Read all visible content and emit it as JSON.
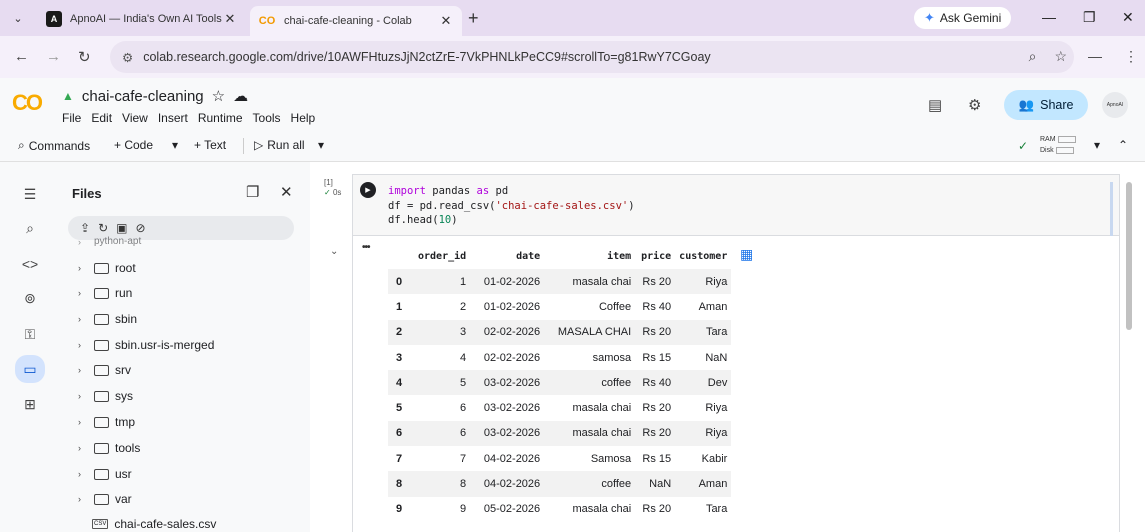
{
  "browser": {
    "tabs": [
      {
        "title": "ApnoAI — India's Own AI Tools",
        "favicon": "A"
      },
      {
        "title": "chai-cafe-cleaning - Colab",
        "favicon": "CO"
      }
    ],
    "gemini_label": "Ask Gemini",
    "url": "colab.research.google.com/drive/10AWFHtuzsJjN2ctZrE-7VkPHNLkPeCC9#scrollTo=g81RwY7CGoay"
  },
  "colab": {
    "logo": "CO",
    "notebook_title": "chai-cafe-cleaning",
    "menu": [
      "File",
      "Edit",
      "View",
      "Insert",
      "Runtime",
      "Tools",
      "Help"
    ],
    "share_label": "Share",
    "avatar_text": "ApnoAI",
    "toolbar": {
      "commands": "Commands",
      "code": "+ Code",
      "text": "+ Text",
      "run_all": "Run all",
      "ram": "RAM",
      "disk": "Disk"
    }
  },
  "files_panel": {
    "title": "Files",
    "partial_item": "python-apt",
    "tree": [
      "root",
      "run",
      "sbin",
      "sbin.usr-is-merged",
      "srv",
      "sys",
      "tmp",
      "tools",
      "usr",
      "var"
    ],
    "csv_file": "chai-cafe-sales.csv"
  },
  "cell": {
    "exec_count": "[1]",
    "exec_time": "0s",
    "code_lines": [
      {
        "kw": "import",
        "rest": " pandas ",
        "kw2": "as",
        "rest2": " pd"
      },
      {
        "pre": "df = pd.read_csv(",
        "str": "'chai-cafe-sales.csv'",
        "post": ")"
      },
      {
        "pre": "df.head(",
        "num": "10",
        "post": ")"
      }
    ]
  },
  "output": {
    "columns": [
      "order_id",
      "date",
      "item",
      "price",
      "customer"
    ],
    "rows": [
      {
        "idx": "0",
        "order_id": "1",
        "date": "01-02-2026",
        "item": "masala chai",
        "price": "Rs 20",
        "customer": "Riya"
      },
      {
        "idx": "1",
        "order_id": "2",
        "date": "01-02-2026",
        "item": "Coffee",
        "price": "Rs 40",
        "customer": "Aman"
      },
      {
        "idx": "2",
        "order_id": "3",
        "date": "02-02-2026",
        "item": "MASALA CHAI",
        "price": "Rs 20",
        "customer": "Tara"
      },
      {
        "idx": "3",
        "order_id": "4",
        "date": "02-02-2026",
        "item": "samosa",
        "price": "Rs 15",
        "customer": "NaN"
      },
      {
        "idx": "4",
        "order_id": "5",
        "date": "03-02-2026",
        "item": "coffee",
        "price": "Rs 40",
        "customer": "Dev"
      },
      {
        "idx": "5",
        "order_id": "6",
        "date": "03-02-2026",
        "item": "masala chai",
        "price": "Rs 20",
        "customer": "Riya"
      },
      {
        "idx": "6",
        "order_id": "6",
        "date": "03-02-2026",
        "item": "masala chai",
        "price": "Rs 20",
        "customer": "Riya"
      },
      {
        "idx": "7",
        "order_id": "7",
        "date": "04-02-2026",
        "item": "Samosa",
        "price": "Rs 15",
        "customer": "Kabir"
      },
      {
        "idx": "8",
        "order_id": "8",
        "date": "04-02-2026",
        "item": "coffee",
        "price": "NaN",
        "customer": "Aman"
      },
      {
        "idx": "9",
        "order_id": "9",
        "date": "05-02-2026",
        "item": "masala chai",
        "price": "Rs 20",
        "customer": "Tara"
      }
    ]
  },
  "colors": {
    "accent": "#0b57d0",
    "share_bg": "#c2e7ff",
    "tab_strip": "#e7dcf1",
    "logo": "#f9ab00"
  },
  "icons": {
    "rail": [
      "table-of-contents-icon",
      "find-icon",
      "code-snippets-icon",
      "variables-icon",
      "secrets-icon",
      "files-icon",
      "terminal-icon"
    ]
  }
}
